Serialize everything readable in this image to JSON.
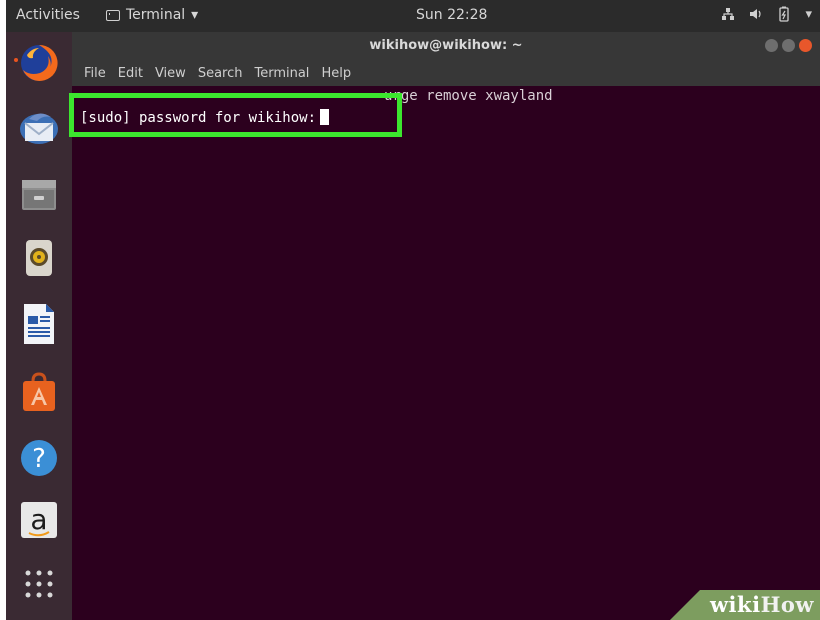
{
  "topbar": {
    "activities": "Activities",
    "app_name": "Terminal",
    "app_menu_arrow": "▾",
    "clock": "Sun 22:28",
    "tray_icons": [
      "network-icon",
      "volume-icon",
      "battery-icon",
      "chevron-down-icon"
    ],
    "tray_arrow": "▾"
  },
  "dock": {
    "items": [
      {
        "name": "firefox-icon"
      },
      {
        "name": "thunderbird-icon"
      },
      {
        "name": "files-icon"
      },
      {
        "name": "rhythmbox-icon"
      },
      {
        "name": "libreoffice-writer-icon"
      },
      {
        "name": "ubuntu-software-icon"
      },
      {
        "name": "help-icon",
        "glyph": "?"
      },
      {
        "name": "amazon-icon",
        "glyph": "a"
      },
      {
        "name": "show-applications-icon"
      }
    ]
  },
  "terminal": {
    "window_title": "wikihow@wikihow: ~",
    "menu": [
      "File",
      "Edit",
      "View",
      "Search",
      "Terminal",
      "Help"
    ],
    "lines": {
      "line1_visible": "urge remove xwayland",
      "line2": "[sudo] password for wikihow:"
    }
  },
  "watermark": {
    "wiki": "wiki",
    "how": "How"
  },
  "colors": {
    "terminal_bg": "#2c001e",
    "highlight": "#3ce62e",
    "accent": "#e95420"
  }
}
